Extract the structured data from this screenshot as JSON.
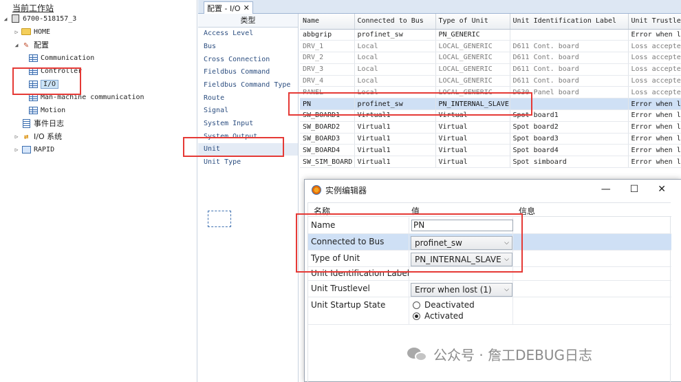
{
  "tree": {
    "title": "当前工作站",
    "controller": "6700-518157_3",
    "home": "HOME",
    "config": "配置",
    "config_children": [
      "Communication",
      "Controller",
      "I/O",
      "Man-machine communication",
      "Motion"
    ],
    "event_log": "事件日志",
    "io_system": "I/O 系统",
    "rapid": "RAPID"
  },
  "tab": {
    "label": "配置 - I/O",
    "close": "✕"
  },
  "type_list": {
    "header": "类型",
    "items": [
      "Access Level",
      "Bus",
      "Cross Connection",
      "Fieldbus Command",
      "Fieldbus Command Type",
      "Route",
      "Signal",
      "System Input",
      "System Output",
      "Unit",
      "Unit Type"
    ],
    "selected": "Unit"
  },
  "grid": {
    "columns": [
      "Name",
      "Connected to Bus",
      "Type of Unit",
      "Unit Identification Label",
      "Unit Trustlevel"
    ],
    "rows": [
      [
        "abbgrip",
        "profinet_sw",
        "PN_GENERIC",
        "",
        "Error when lost"
      ],
      [
        "DRV_1",
        "Local",
        "LOCAL_GENERIC",
        "D611 Cont. board",
        "Loss accepted"
      ],
      [
        "DRV_2",
        "Local",
        "LOCAL_GENERIC",
        "D611 Cont. board",
        "Loss accepted"
      ],
      [
        "DRV_3",
        "Local",
        "LOCAL_GENERIC",
        "D611 Cont. board",
        "Loss accepted"
      ],
      [
        "DRV_4",
        "Local",
        "LOCAL_GENERIC",
        "D611 Cont. board",
        "Loss accepted"
      ],
      [
        "PANEL",
        "Local",
        "LOCAL_GENERIC",
        "D630 Panel board",
        "Loss accepted"
      ],
      [
        "PN",
        "profinet_sw",
        "PN_INTERNAL_SLAVE",
        "",
        "Error when lost"
      ],
      [
        "SW_BOARD1",
        "Virtual1",
        "Virtual",
        "Spot board1",
        "Error when lost"
      ],
      [
        "SW_BOARD2",
        "Virtual1",
        "Virtual",
        "Spot board2",
        "Error when lost"
      ],
      [
        "SW_BOARD3",
        "Virtual1",
        "Virtual",
        "Spot board3",
        "Error when lost"
      ],
      [
        "SW_BOARD4",
        "Virtual1",
        "Virtual",
        "Spot board4",
        "Error when lost"
      ],
      [
        "SW_SIM_BOARD",
        "Virtual1",
        "Virtual",
        "Spot simboard",
        "Error when lost"
      ]
    ]
  },
  "editor": {
    "title": "实例编辑器",
    "col_name": "名称",
    "col_value": "值",
    "col_info": "信息",
    "name_label": "Name",
    "name_value": "PN",
    "bus_label": "Connected to Bus",
    "bus_value": "profinet_sw",
    "type_label": "Type of Unit",
    "type_value": "PN_INTERNAL_SLAVE",
    "ident_label": "Unit Identification Label",
    "trust_label": "Unit Trustlevel",
    "trust_value": "Error when lost (1)",
    "startup_label": "Unit Startup State",
    "opt_deactivated": "Deactivated",
    "opt_activated": "Activated",
    "activated": true
  },
  "watermark": "公众号 · 詹工DEBUG日志"
}
